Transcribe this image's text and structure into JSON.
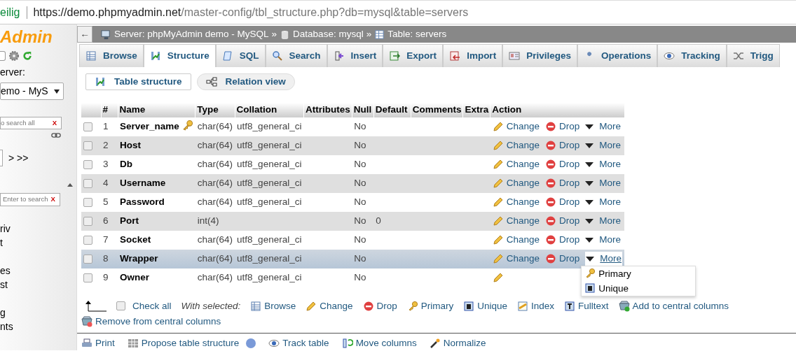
{
  "address_bar": {
    "security": "eilig",
    "url_host": "https://demo.phpmyadmin.net",
    "url_path": "/master-config/tbl_structure.php?db=mysql&table=servers"
  },
  "sidebar": {
    "logo": "Admin",
    "server_label": "erver:",
    "server_select": "emo - MyS",
    "filter_placeholder": "o search all",
    "filter_clear": "X",
    "pager": "> >>",
    "filter2_placeholder": "Enter to search",
    "filter2_clear": "X",
    "items": [
      "riv",
      "t",
      "es",
      "st",
      "g",
      "nts"
    ]
  },
  "breadcrumb": {
    "back": "←",
    "server": "Server: phpMyAdmin demo - MySQL",
    "sep1": "»",
    "database": "Database: mysql",
    "sep2": "»",
    "table": "Table: servers"
  },
  "tabs": [
    {
      "label": "Browse",
      "kind": "browse",
      "selected": false
    },
    {
      "label": "Structure",
      "kind": "structure",
      "selected": true
    },
    {
      "label": "SQL",
      "kind": "sql",
      "selected": false
    },
    {
      "label": "Search",
      "kind": "search",
      "selected": false
    },
    {
      "label": "Insert",
      "kind": "insert",
      "selected": false
    },
    {
      "label": "Export",
      "kind": "export",
      "selected": false
    },
    {
      "label": "Import",
      "kind": "import",
      "selected": false
    },
    {
      "label": "Privileges",
      "kind": "privileges",
      "selected": false
    },
    {
      "label": "Operations",
      "kind": "operations",
      "selected": false
    },
    {
      "label": "Tracking",
      "kind": "tracking",
      "selected": false
    },
    {
      "label": "Trigg",
      "kind": "triggers",
      "selected": false
    }
  ],
  "subtabs": [
    {
      "label": "Table structure",
      "kind": "structure",
      "selected": true
    },
    {
      "label": "Relation view",
      "kind": "relation",
      "selected": false
    }
  ],
  "table": {
    "columns": [
      "#",
      "Name",
      "Type",
      "Collation",
      "Attributes",
      "Null",
      "Default",
      "Comments",
      "Extra",
      "Action"
    ],
    "rows": [
      {
        "num": "1",
        "name": "Server_name",
        "primary": true,
        "type": "char(64)",
        "collation": "utf8_general_ci",
        "null": "No",
        "actions": [
          "Change",
          "Drop",
          "More"
        ],
        "hovered": false,
        "checked": false
      },
      {
        "num": "2",
        "name": "Host",
        "primary": false,
        "type": "char(64)",
        "collation": "utf8_general_ci",
        "null": "No",
        "actions": [
          "Change",
          "Drop",
          "More"
        ],
        "hovered": false,
        "checked": false
      },
      {
        "num": "3",
        "name": "Db",
        "primary": false,
        "type": "char(64)",
        "collation": "utf8_general_ci",
        "null": "No",
        "actions": [
          "Change",
          "Drop",
          "More"
        ],
        "hovered": false,
        "checked": false
      },
      {
        "num": "4",
        "name": "Username",
        "primary": false,
        "type": "char(64)",
        "collation": "utf8_general_ci",
        "null": "No",
        "actions": [
          "Change",
          "Drop",
          "More"
        ],
        "hovered": false,
        "checked": false
      },
      {
        "num": "5",
        "name": "Password",
        "primary": false,
        "type": "char(64)",
        "collation": "utf8_general_ci",
        "null": "No",
        "actions": [
          "Change",
          "Drop",
          "More"
        ],
        "hovered": false,
        "checked": false
      },
      {
        "num": "6",
        "name": "Port",
        "primary": false,
        "type": "int(4)",
        "null": "No",
        "default": "0",
        "actions": [
          "Change",
          "Drop",
          "More"
        ],
        "hovered": false,
        "checked": false
      },
      {
        "num": "7",
        "name": "Socket",
        "primary": false,
        "type": "char(64)",
        "collation": "utf8_general_ci",
        "null": "No",
        "actions": [
          "Change",
          "Drop",
          "More"
        ],
        "hovered": false,
        "checked": false
      },
      {
        "num": "8",
        "name": "Wrapper",
        "primary": false,
        "type": "char(64)",
        "collation": "utf8_general_ci",
        "null": "No",
        "actions": [
          "Change",
          "Drop",
          "More"
        ],
        "hovered": true,
        "checked": false,
        "menu": [
          "Primary",
          "Unique"
        ]
      },
      {
        "num": "9",
        "name": "Owner",
        "primary": false,
        "type": "char(64)",
        "collation": "utf8_general_ci",
        "null": "No",
        "actions": [],
        "hovered": false,
        "checked": false
      }
    ]
  },
  "bulk": {
    "check_all": "Check all",
    "checked": false,
    "with_selected": "With selected:",
    "actions": [
      {
        "label": "Browse",
        "kind": "browse"
      },
      {
        "label": "Change",
        "kind": "change"
      },
      {
        "label": "Drop",
        "kind": "drop"
      },
      {
        "label": "Primary",
        "kind": "primary"
      },
      {
        "label": "Unique",
        "kind": "unique"
      },
      {
        "label": "Index",
        "kind": "index"
      },
      {
        "label": "Fulltext",
        "kind": "fulltext"
      },
      {
        "label": "Add to central columns",
        "kind": "add_central"
      },
      {
        "label": "Remove from central columns",
        "kind": "remove_central"
      }
    ]
  },
  "footer_links": [
    {
      "label": "Print",
      "kind": "print"
    },
    {
      "label": "Propose table structure",
      "kind": "propose",
      "help": true
    },
    {
      "label": "Track table",
      "kind": "tracking"
    },
    {
      "label": "Move columns",
      "kind": "move"
    },
    {
      "label": "Normalize",
      "kind": "normalize"
    }
  ]
}
